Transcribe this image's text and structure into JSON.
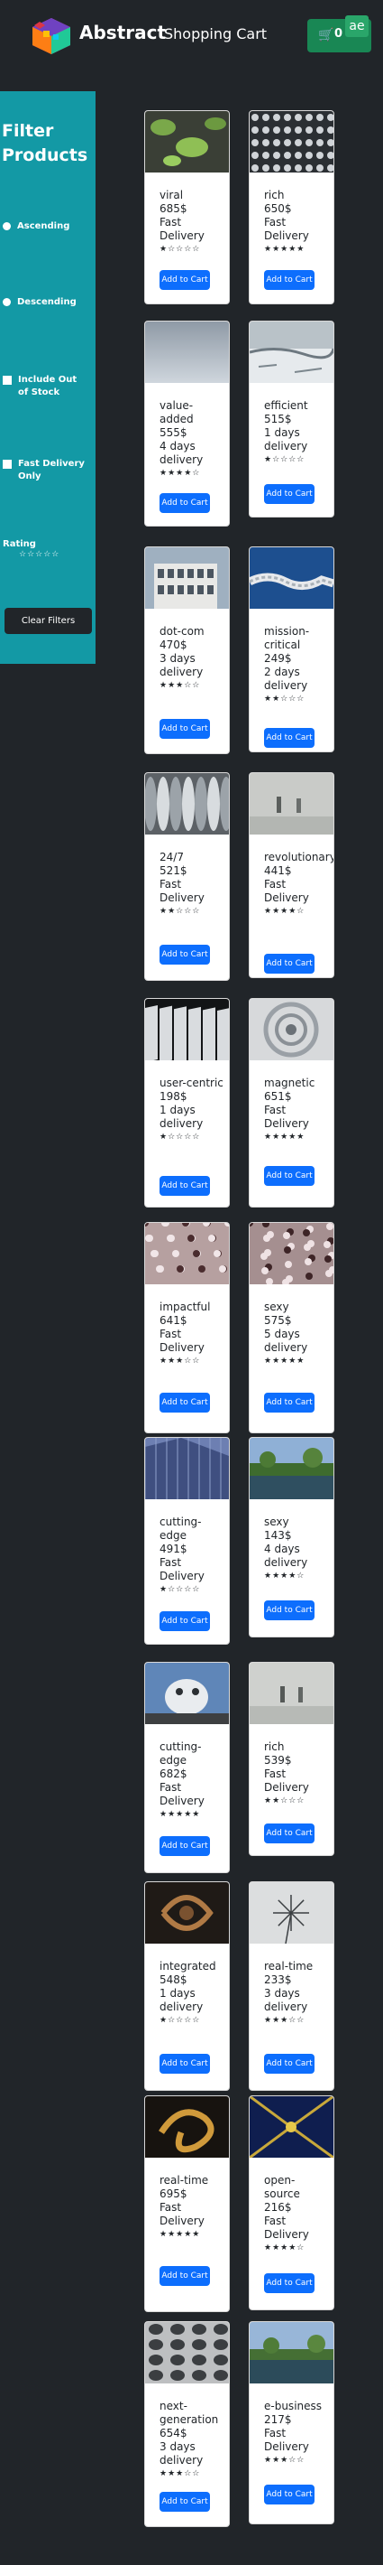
{
  "nav": {
    "brand": "Abstract",
    "title": "Shopping Cart",
    "cart_count": "0",
    "badge": "ae"
  },
  "filters": {
    "title": "Filter Products",
    "ascending": "Ascending",
    "descending": "Descending",
    "include_out_of_stock": "Include Out of Stock",
    "fast_delivery_only": "Fast Delivery Only",
    "rating_label": "Rating",
    "rating_stars": "☆☆☆☆☆",
    "clear_label": "Clear Filters"
  },
  "add_to_cart_label": "Add to Cart",
  "products": [
    {
      "name": "viral",
      "price": "685$",
      "delivery": "Fast Delivery",
      "rating": 1,
      "image": "lily-pads"
    },
    {
      "name": "rich",
      "price": "650$",
      "delivery": "Fast Delivery",
      "rating": 5,
      "image": "perforated-metal"
    },
    {
      "name": "value-added",
      "price": "555$",
      "delivery": "4 days delivery",
      "rating": 4,
      "image": "grey-sky"
    },
    {
      "name": "efficient",
      "price": "515$",
      "delivery": "1 days delivery",
      "rating": 1,
      "image": "frozen-lake"
    },
    {
      "name": "dot-com",
      "price": "470$",
      "delivery": "3 days delivery",
      "rating": 3,
      "image": "white-building"
    },
    {
      "name": "mission-critical",
      "price": "249$",
      "delivery": "2 days delivery",
      "rating": 2,
      "image": "rope-knot"
    },
    {
      "name": "24/7",
      "price": "521$",
      "delivery": "Fast Delivery",
      "rating": 2,
      "image": "metal-tubes"
    },
    {
      "name": "revolutionary",
      "price": "441$",
      "delivery": "Fast Delivery",
      "rating": 4,
      "image": "foggy-walkers"
    },
    {
      "name": "user-centric",
      "price": "198$",
      "delivery": "1 days delivery",
      "rating": 1,
      "image": "dark-facade"
    },
    {
      "name": "magnetic",
      "price": "651$",
      "delivery": "Fast Delivery",
      "rating": 5,
      "image": "spiral-architecture"
    },
    {
      "name": "impactful",
      "price": "641$",
      "delivery": "Fast Delivery",
      "rating": 3,
      "image": "blossom-branches"
    },
    {
      "name": "sexy",
      "price": "575$",
      "delivery": "5 days delivery",
      "rating": 5,
      "image": "blossom-branches-2"
    },
    {
      "name": "cutting-edge",
      "price": "491$",
      "delivery": "Fast Delivery",
      "rating": 1,
      "image": "glass-tower"
    },
    {
      "name": "sexy",
      "price": "143$",
      "delivery": "4 days delivery",
      "rating": 4,
      "image": "park-pond"
    },
    {
      "name": "cutting-edge",
      "price": "682$",
      "delivery": "Fast Delivery",
      "rating": 5,
      "image": "bird-statue"
    },
    {
      "name": "rich",
      "price": "539$",
      "delivery": "Fast Delivery",
      "rating": 2,
      "image": "foggy-walkers-2"
    },
    {
      "name": "integrated",
      "price": "548$",
      "delivery": "1 days delivery",
      "rating": 1,
      "image": "bronze-swirl"
    },
    {
      "name": "real-time",
      "price": "233$",
      "delivery": "3 days delivery",
      "rating": 3,
      "image": "dandelion-seeds"
    },
    {
      "name": "real-time",
      "price": "695$",
      "delivery": "Fast Delivery",
      "rating": 5,
      "image": "golden-swirl"
    },
    {
      "name": "open-source",
      "price": "216$",
      "delivery": "Fast Delivery",
      "rating": 4,
      "image": "blue-ceiling"
    },
    {
      "name": "next-generation",
      "price": "654$",
      "delivery": "3 days delivery",
      "rating": 3,
      "image": "honeycomb-wall"
    },
    {
      "name": "e-business",
      "price": "217$",
      "delivery": "Fast Delivery",
      "rating": 3,
      "image": "park-pond-2"
    }
  ]
}
